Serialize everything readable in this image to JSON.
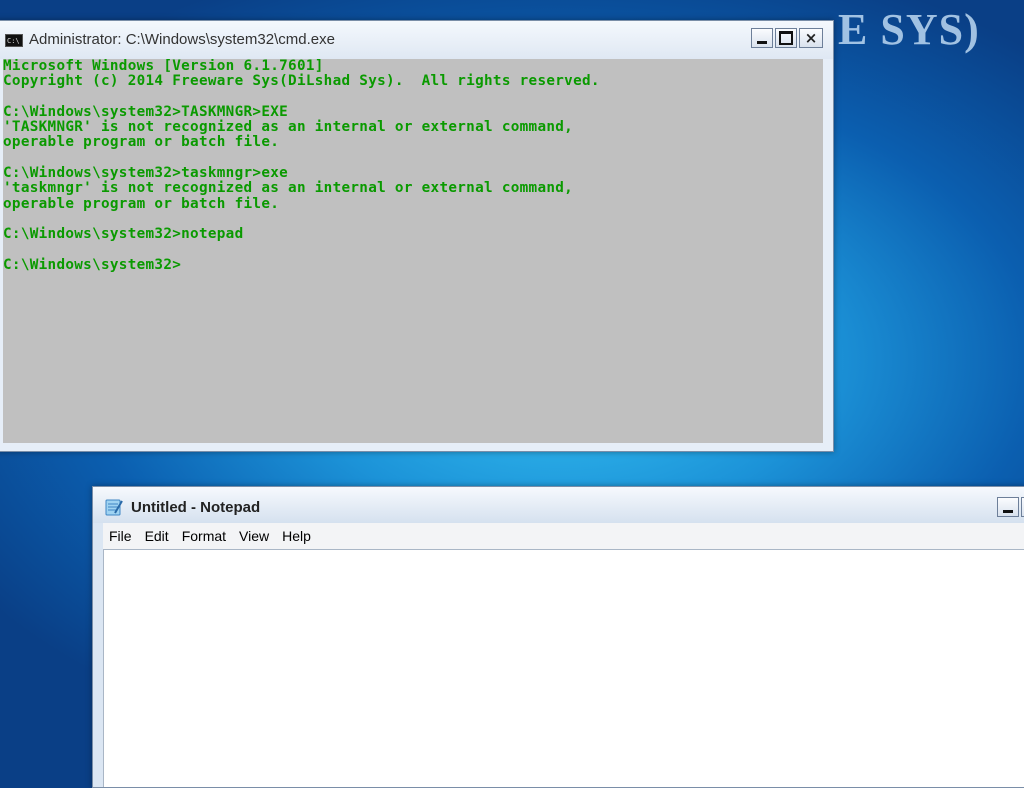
{
  "wallpaper": {
    "text": "E SYS)"
  },
  "cmd": {
    "title": "Administrator: C:\\Windows\\system32\\cmd.exe",
    "icon_label": "C:\\",
    "lines": [
      "Microsoft Windows [Version 6.1.7601]",
      "Copyright (c) 2014 Freeware Sys(DiLshad Sys).  All rights reserved.",
      "",
      "C:\\Windows\\system32>TASKMNGR>EXE",
      "'TASKMNGR' is not recognized as an internal or external command,",
      "operable program or batch file.",
      "",
      "C:\\Windows\\system32>taskmngr>exe",
      "'taskmngr' is not recognized as an internal or external command,",
      "operable program or batch file.",
      "",
      "C:\\Windows\\system32>notepad",
      "",
      "C:\\Windows\\system32>"
    ],
    "buttons": {
      "close": "×"
    },
    "colors": {
      "console_bg": "#c0c0c0",
      "console_text": "#0a9a00"
    }
  },
  "notepad": {
    "title": "Untitled - Notepad",
    "menu": [
      "File",
      "Edit",
      "Format",
      "View",
      "Help"
    ],
    "content": ""
  },
  "icons": {
    "cmd": "command-prompt-icon",
    "notepad": "notepad-icon",
    "minimize": "minimize-icon",
    "maximize": "maximize-icon",
    "close": "close-icon"
  }
}
